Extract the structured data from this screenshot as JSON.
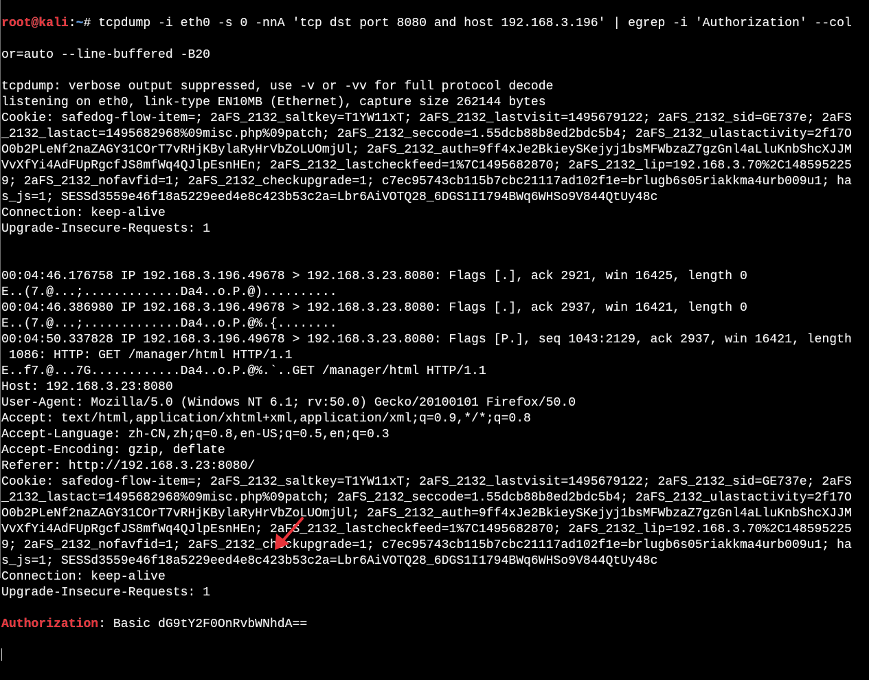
{
  "terminal": {
    "prompt": {
      "user_host": "root@kali",
      "separator": ":",
      "path": "~",
      "symbol": "# ",
      "command": "tcpdump -i eth0 -s 0 -nnA 'tcp dst port 8080 and host 192.168.3.196' | egrep -i 'Authorization' --col",
      "command_cont": "or=auto --line-buffered -B20"
    },
    "lines": [
      "tcpdump: verbose output suppressed, use -v or -vv for full protocol decode",
      "listening on eth0, link-type EN10MB (Ethernet), capture size 262144 bytes",
      "Cookie: safedog-flow-item=; 2aFS_2132_saltkey=T1YW11xT; 2aFS_2132_lastvisit=1495679122; 2aFS_2132_sid=GE737e; 2aFS",
      "_2132_lastact=1495682968%09misc.php%09patch; 2aFS_2132_seccode=1.55dcb88b8ed2bdc5b4; 2aFS_2132_ulastactivity=2f17O",
      "O0b2PLeNf2naZAGY31COrT7vRHjKBylaRyHrVbZoLUOmjUl; 2aFS_2132_auth=9ff4xJe2BkieySKejyj1bsMFWbzaZ7gzGnl4aLluKnbShcXJJM",
      "VvXfYi4AdFUpRgcfJS8mfWq4QJlpEsnHEn; 2aFS_2132_lastcheckfeed=1%7C1495682870; 2aFS_2132_lip=192.168.3.70%2C148595225",
      "9; 2aFS_2132_nofavfid=1; 2aFS_2132_checkupgrade=1; c7ec95743cb115b7cbc21117ad102f1e=brlugb6s05riakkma4urb009u1; ha",
      "s_js=1; SESSd3559e46f18a5229eed4e8c423b53c2a=Lbr6AiVOTQ28_6DGS1I1794BWq6WHSo9V844QtUy48c",
      "Connection: keep-alive",
      "Upgrade-Insecure-Requests: 1",
      "",
      "",
      "00:04:46.176758 IP 192.168.3.196.49678 > 192.168.3.23.8080: Flags [.], ack 2921, win 16425, length 0",
      "E..(7.@...;.............Da4..o.P.@)..........",
      "00:04:46.386980 IP 192.168.3.196.49678 > 192.168.3.23.8080: Flags [.], ack 2937, win 16421, length 0",
      "E..(7.@...;.............Da4..o.P.@%.{........",
      "00:04:50.337828 IP 192.168.3.196.49678 > 192.168.3.23.8080: Flags [P.], seq 1043:2129, ack 2937, win 16421, length",
      " 1086: HTTP: GET /manager/html HTTP/1.1",
      "E..f7.@...7G............Da4..o.P.@%.`..GET /manager/html HTTP/1.1",
      "Host: 192.168.3.23:8080",
      "User-Agent: Mozilla/5.0 (Windows NT 6.1; rv:50.0) Gecko/20100101 Firefox/50.0",
      "Accept: text/html,application/xhtml+xml,application/xml;q=0.9,*/*;q=0.8",
      "Accept-Language: zh-CN,zh;q=0.8,en-US;q=0.5,en;q=0.3",
      "Accept-Encoding: gzip, deflate",
      "Referer: http://192.168.3.23:8080/",
      "Cookie: safedog-flow-item=; 2aFS_2132_saltkey=T1YW11xT; 2aFS_2132_lastvisit=1495679122; 2aFS_2132_sid=GE737e; 2aFS",
      "_2132_lastact=1495682968%09misc.php%09patch; 2aFS_2132_seccode=1.55dcb88b8ed2bdc5b4; 2aFS_2132_ulastactivity=2f17O",
      "O0b2PLeNf2naZAGY31COrT7vRHjKBylaRyHrVbZoLUOmjUl; 2aFS_2132_auth=9ff4xJe2BkieySKejyj1bsMFWbzaZ7gzGnl4aLluKnbShcXJJM",
      "VvXfYi4AdFUpRgcfJS8mfWq4QJlpEsnHEn; 2aFS_2132_lastcheckfeed=1%7C1495682870; 2aFS_2132_lip=192.168.3.70%2C148595225",
      "9; 2aFS_2132_nofavfid=1; 2aFS_2132_checkupgrade=1; c7ec95743cb115b7cbc21117ad102f1e=brlugb6s05riakkma4urb009u1; ha",
      "s_js=1; SESSd3559e46f18a5229eed4e8c423b53c2a=Lbr6AiVOTQ28_6DGS1I1794BWq6WHSo9V844QtUy48c",
      "Connection: keep-alive",
      "Upgrade-Insecure-Requests: 1"
    ],
    "match_line": {
      "keyword": "Authorization",
      "rest": ": Basic dG9tY2F0OnRvbWNhdA=="
    }
  },
  "annotation": {
    "type": "arrow",
    "color": "#e8333a",
    "points_to": "Authorization header value"
  },
  "colors": {
    "background": "#000000",
    "foreground": "#f2f2f2",
    "prompt_user": "#e8333a",
    "prompt_path": "#5a9be6",
    "grep_highlight": "#e8333a"
  }
}
